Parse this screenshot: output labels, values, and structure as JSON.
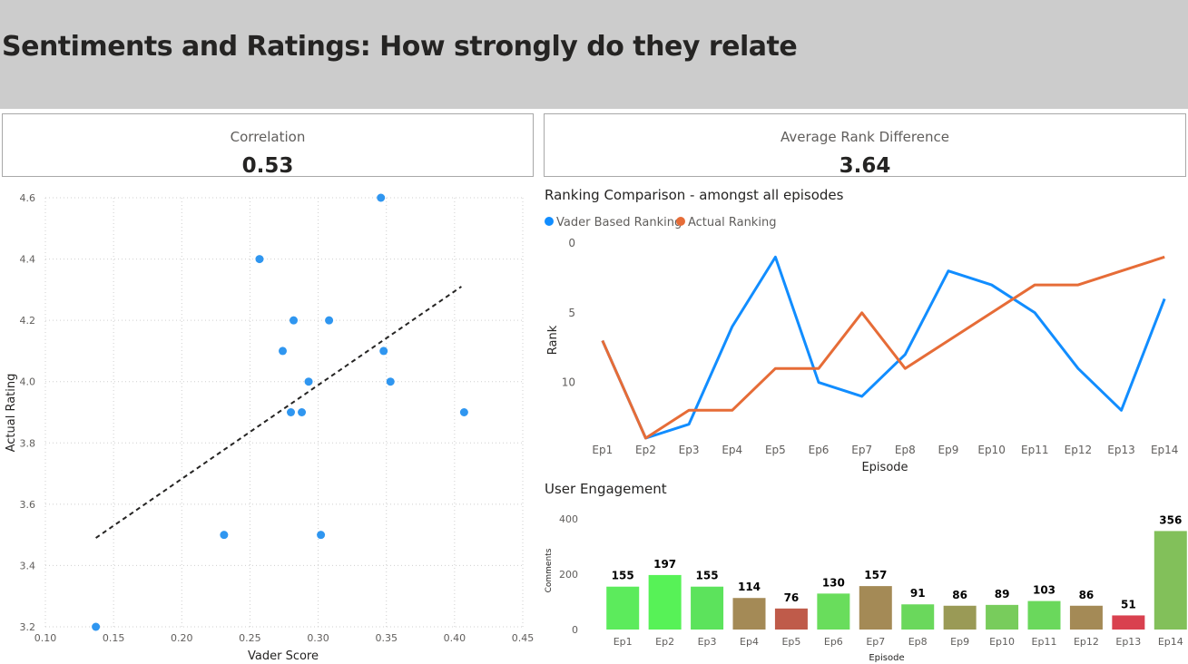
{
  "header": {
    "title": "Sentiments and Ratings: How strongly do they relate"
  },
  "cards": [
    {
      "label": "Correlation",
      "value": "0.53"
    },
    {
      "label": "Average Rank Difference",
      "value": "3.64"
    }
  ],
  "colors": {
    "header_bg": "#cccccc",
    "vader": "#118dff",
    "actual": "#e66c37",
    "scatter_point": "#2f96f0",
    "trendline": "#252423"
  },
  "chart_data": [
    {
      "type": "scatter",
      "title": "",
      "xlabel": "Vader Score",
      "ylabel": "Actual Rating",
      "xlim": [
        0.1,
        0.45
      ],
      "ylim": [
        3.2,
        4.6
      ],
      "xticks": [
        "0.10",
        "0.15",
        "0.20",
        "0.25",
        "0.30",
        "0.35",
        "0.40",
        "0.45"
      ],
      "yticks": [
        "3.2",
        "3.4",
        "3.6",
        "3.8",
        "4.0",
        "4.2",
        "4.4",
        "4.6"
      ],
      "points": [
        {
          "x": 0.137,
          "y": 3.2
        },
        {
          "x": 0.231,
          "y": 3.5
        },
        {
          "x": 0.257,
          "y": 4.4
        },
        {
          "x": 0.274,
          "y": 4.1
        },
        {
          "x": 0.28,
          "y": 3.9
        },
        {
          "x": 0.282,
          "y": 4.2
        },
        {
          "x": 0.288,
          "y": 3.9
        },
        {
          "x": 0.293,
          "y": 4.0
        },
        {
          "x": 0.302,
          "y": 3.5
        },
        {
          "x": 0.308,
          "y": 4.2
        },
        {
          "x": 0.346,
          "y": 4.6
        },
        {
          "x": 0.348,
          "y": 4.1
        },
        {
          "x": 0.353,
          "y": 4.0
        },
        {
          "x": 0.407,
          "y": 3.9
        }
      ],
      "trendline": {
        "x": [
          0.137,
          0.405
        ],
        "y": [
          3.49,
          4.31
        ]
      },
      "grid": true
    },
    {
      "type": "line",
      "title": "Ranking Comparison - amongst all episodes",
      "xlabel": "Episode",
      "ylabel": "Rank",
      "categories": [
        "Ep1",
        "Ep2",
        "Ep3",
        "Ep4",
        "Ep5",
        "Ep6",
        "Ep7",
        "Ep8",
        "Ep9",
        "Ep10",
        "Ep11",
        "Ep12",
        "Ep13",
        "Ep14"
      ],
      "y_reversed": true,
      "ylim": [
        0,
        14
      ],
      "yticks": [
        "0",
        "5",
        "10"
      ],
      "legend_position": "top-left",
      "series": [
        {
          "name": "Vader Based Ranking",
          "values": [
            7,
            14,
            13,
            6,
            1,
            10,
            11,
            8,
            2,
            3,
            5,
            9,
            12,
            4
          ]
        },
        {
          "name": "Actual Ranking",
          "values": [
            7,
            14,
            12,
            12,
            9,
            9,
            5,
            9,
            7,
            5,
            3,
            3,
            2,
            1
          ]
        }
      ]
    },
    {
      "type": "bar",
      "title": "User Engagement",
      "xlabel": "Episode",
      "ylabel": "Comments",
      "categories": [
        "Ep1",
        "Ep2",
        "Ep3",
        "Ep4",
        "Ep5",
        "Ep6",
        "Ep7",
        "Ep8",
        "Ep9",
        "Ep10",
        "Ep11",
        "Ep12",
        "Ep13",
        "Ep14"
      ],
      "values": [
        155,
        197,
        155,
        114,
        76,
        130,
        157,
        91,
        86,
        89,
        103,
        86,
        51,
        356
      ],
      "colors": [
        "#5ceb5c",
        "#57f257",
        "#5ce35c",
        "#a48a56",
        "#bf5b4a",
        "#69dd5c",
        "#a48a56",
        "#6ad85c",
        "#9a9a56",
        "#78cc5c",
        "#6ad85c",
        "#a48a56",
        "#d9414f",
        "#82c05a"
      ],
      "ylim": [
        0,
        400
      ],
      "yticks": [
        "0",
        "200",
        "400"
      ],
      "data_labels": true
    }
  ]
}
